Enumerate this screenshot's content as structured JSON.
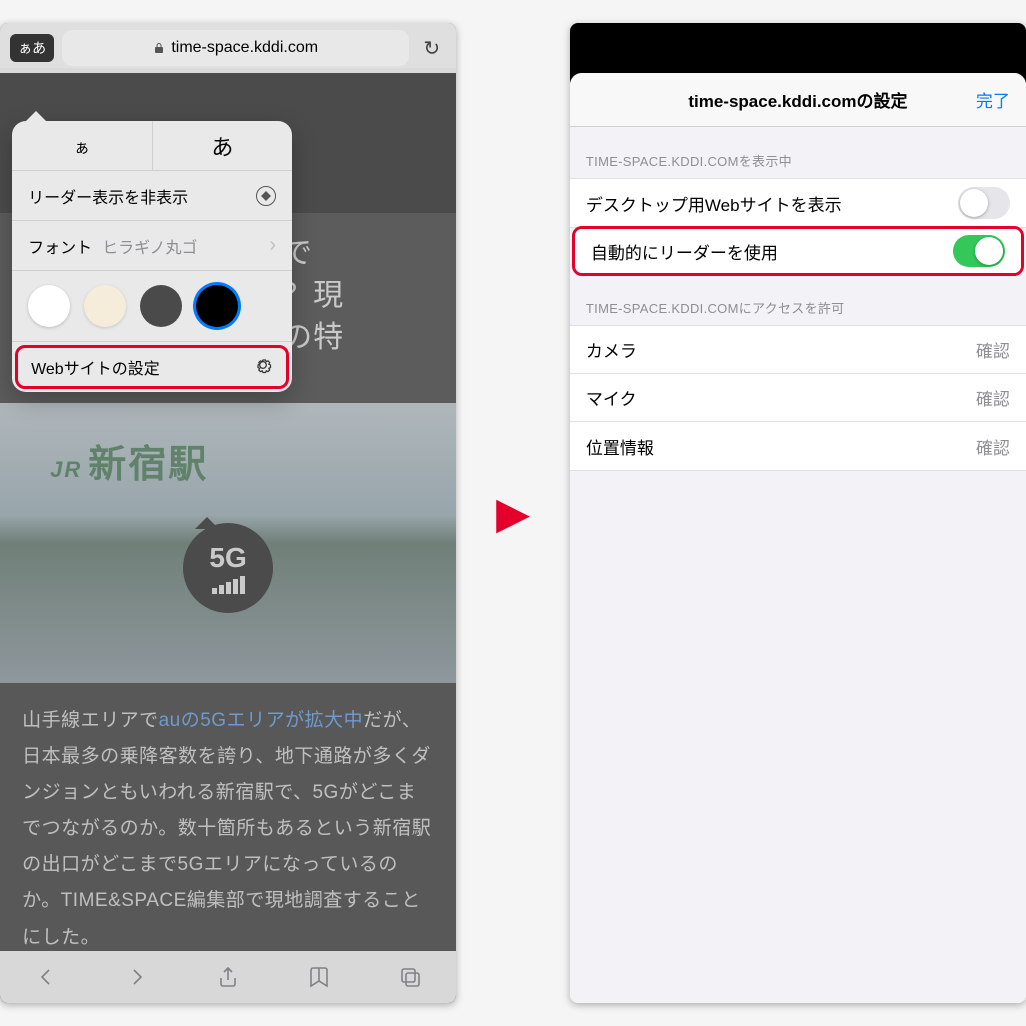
{
  "left": {
    "aa_button": "ぁあ",
    "url": "time-space.kddi.com",
    "popover": {
      "font_small": "ぁ",
      "font_large": "あ",
      "hide_reader": "リーダー表示を非表示",
      "font_label": "フォント",
      "font_value": "ヒラギノ丸ゴ",
      "website_settings": "Webサイトの設定"
    },
    "article": {
      "title_fragment_1": "か所で",
      "title_fragment_2": "のか？現",
      "title_fragment_3": "電波の特",
      "station": "新宿駅",
      "badge": "5G",
      "body_prefix": "山手線エリアで",
      "body_link": "auの5Gエリアが拡大中",
      "body_rest": "だが、日本最多の乗降客数を誇り、地下通路が多くダンジョンともいわれる新宿駅で、5Gがどこまでつながるのか。数十箇所もあるという新宿駅の出口がどこまで5Gエリアになっているのか。TIME&SPACE編集部で現地調査することにした。"
    }
  },
  "right": {
    "title": "time-space.kddi.comの設定",
    "done": "完了",
    "section1_header": "TIME-SPACE.KDDI.COMを表示中",
    "desktop_site": "デスクトップ用Webサイトを表示",
    "auto_reader": "自動的にリーダーを使用",
    "section2_header": "TIME-SPACE.KDDI.COMにアクセスを許可",
    "camera": "カメラ",
    "mic": "マイク",
    "location": "位置情報",
    "confirm": "確認"
  }
}
